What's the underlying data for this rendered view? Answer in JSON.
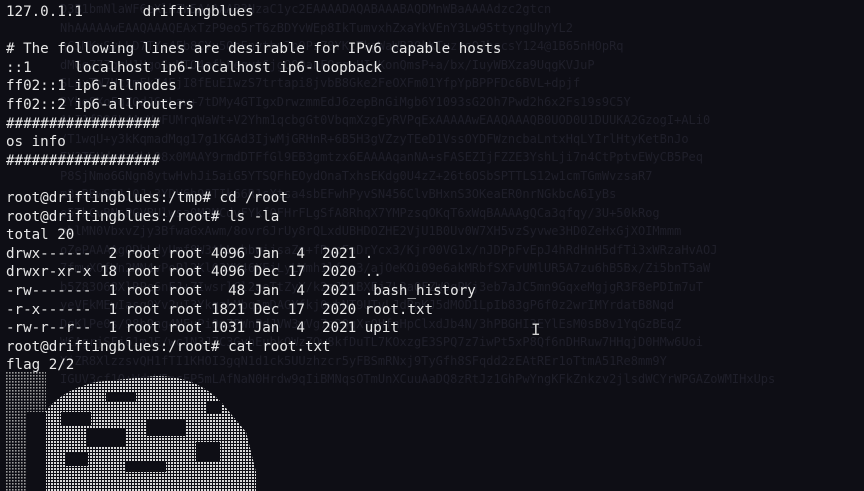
{
  "terminal": {
    "lines": [
      "127.0.1.1       driftingblues",
      "",
      "# The following lines are desirable for IPv6 capable hosts",
      "::1     localhost ip6-localhost ip6-loopback",
      "ff02::1 ip6-allnodes",
      "ff02::2 ip6-allrouters",
      "##################",
      "os info",
      "##################",
      "",
      "root@driftingblues:/tmp# cd /root",
      "root@driftingblues:/root# ls -la",
      "total 20",
      "drwx------  2 root root 4096 Jan  4  2021 .",
      "drwxr-xr-x 18 root root 4096 Dec 17  2020 ..",
      "-rw-------  1 root root   48 Jan  4  2021 .bash_history",
      "-r-x------  1 root root 1821 Dec 17  2020 root.txt",
      "-rw-r--r--  1 root root 1031 Jan  4  2021 upit",
      "root@driftingblues:/root# cat root.txt",
      "flag 2/2"
    ],
    "background_noise": [
      "D3B1bmNlaWF6eXlhZW5AAAAAB3NzaC1yc2EAAAADAQABAAABAQDMnWBaAAAAdzc2gtcn",
      "NhAAAAAwEAAQAAAQEAxTzP9eo5rT6zBDYvWEp8IkTumvxhZxaYkVEnY3Lw95ttyngUhyYL2",
      "qCSMKxSyLLD7TYc4Fb8CYu5ObEnvtbu7pOPzZ8YKzTkgWaWB3OkKTuzrsOJbscsY124@1B65nHOpRq",
      "dMGqZ7ZgzH1HgoSxMTO4efhFegyt6jgOOOanFQrgvUI/KonQmsP+a/bx/IuyWBXza9UqgKVJuP",
      "SLnxTW7HcxmEk74EjI8fEuEIwzS7trtapi8jvbB8Gke2FeOXFm01YfpYpBPPFDc6BVL+dpjf",
      "2Yho8XoFqZQdJ6eLaw+7tDMy4GTIgxDrwzmmEdJ6zepBnGiMgb6Y1093sG2Oh7Pwd2h6x2Fs19s9C5Y",
      "ALI1f29CL4ArVwFUMrqWaWt+V2Yhm1qcbgGt0VbqmXzgEyRVPqExAAAAAwEAAQAAAQB0UOD0U1DUUKA2GzogI+ALi0",
      "/T1wqU+y3kKqmadMqg17g1KGAd3IjwMjGRHnR+6B5H3gVZzyTEeD1VssOYDFWzncbaLntxHqLYIrlHtyKetBnJo",
      "FV3T5HdydzGkL98x0MAAY9rmdDTFfGl9EB3gmtzx6EAAAAqanNA+sFASEZIjFZZE3YshLji7n4CtPptvEWyCB5Peq",
      "P8SjNmo6GNgn8ytwHvhJi5aiG5YTSQFhEOydOnaTxhsEKdg0U4zZ+26t6OSbSPTTLS12w1cmTGmWvzsaR7",
      "m8xRBwSI1j0J+3YDV6b99TIk66R1sXtsa4sbEFwhPyvSN456ClvBHxnS3OKeaER0nrNGkbcA6IyBs",
      "o5ThCvBNsPGVBUlwsa0M2MCdvFYkf0FHrFLgSfA8RhqX7YMPzsqOKqT6xWqBAAAAgQCa3qfqy/3U+50kRog",
      "ohlMN0VbxvZjy3BfwaGxAwm/8ovr6JrUy8rQLxdUBHDOZHE2VjU1B0Uv0W7XH5vzSyvwe3HD0ZeHxGjXOIMmmm",
      "oZePAAAAgQDhLdyUmf8W3tkLyhbwijsaZn+fRypFnDrYcx3/Kjr00VG1x/nJDPpFvEpJ4hRdHnH5dfTi3xWRzaHvAOJ",
      "7fmwXOfWn2MN4vPoPl2Kl03XK46XEiLyLWmh1lfpe3/ajOeKOi09e6akMRbfSXFvUMlUR5A7zu6hB5Bx/Zi5bnT5aW",
      "b5Z83O68XlRPe6nFJ+ZIwsrlCl2aeTtZyY/k2mJWuBXEj7L3aQFZWOqPKj3eb7aJC5mn9GqxeMgjgR3F8ePDIm7uT",
      "yeVFkMEwIasq0Yv2uI3YkqzkMbq1mDAGYfkj0whNT9UTvLJdRpKJ5dMOD1LpIb83gP6f0z2wrIMYrdatB8Nqd",
      "DgKlPe0s/98b9ng4NFuPi0m7PWnPdJVW3wVg7o2QqXrOHfnHpClxdJb4N/3hPBGHI3EYlEsM0sB8v1YqGzBEqZ",
      "WCAgrjSFj61mJE/wc1N3J7C3GyhEubkOWzZOw8kfDuTL7KOxzgE3SPQ7z7iwPt5xP8Qf6nDHRuw7HHqjD0HMw6Uoi",
      "YjZR8XlzzsvQH1fTI1KHOI3gqN1d1ck5UUzhzcr5yFBSmRNxj9TyGfh8SFqdd2zEAtREr1oTtmA51Re8mm9Y",
      "IGUV3cf1Q+WdqW5pcEP5mLAfNaN0Hrdw9qIiBMNqsOTmUnXCuuAaDQ8zRtJz1GhPwYngKFkZnkzv2jlsdWCYrWPGAZoWMIHxUps"
    ]
  }
}
